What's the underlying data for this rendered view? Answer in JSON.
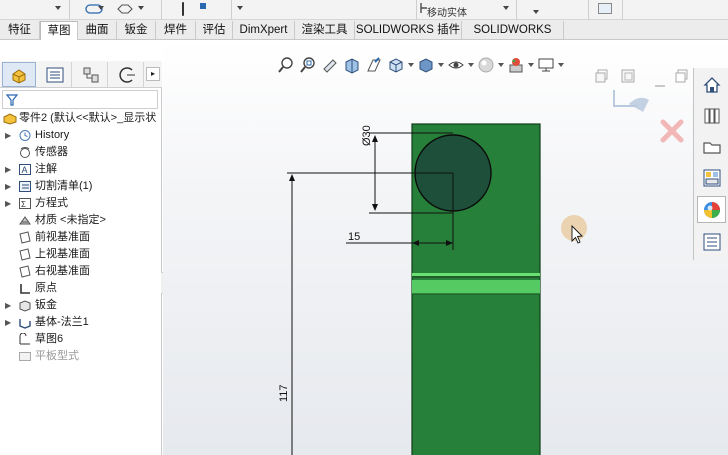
{
  "ribbon": {
    "partial_label": "移动实体",
    "partial_label_right": "…"
  },
  "tabs": [
    {
      "label": "特征",
      "active": false
    },
    {
      "label": "草图",
      "active": true
    },
    {
      "label": "曲面",
      "active": false
    },
    {
      "label": "钣金",
      "active": false
    },
    {
      "label": "焊件",
      "active": false
    },
    {
      "label": "评估",
      "active": false
    },
    {
      "label": "DimXpert",
      "active": false
    },
    {
      "label": "渲染工具",
      "active": false
    },
    {
      "label": "SOLIDWORKS 插件",
      "active": false
    },
    {
      "label": "SOLIDWORKS MBD",
      "active": false
    }
  ],
  "tree": {
    "root": "零件2  (默认<<默认>_显示状",
    "items": [
      {
        "label": "History",
        "icon": "history-icon",
        "expandable": true
      },
      {
        "label": "传感器",
        "icon": "sensor-icon",
        "expandable": false
      },
      {
        "label": "注解",
        "icon": "annotation-icon",
        "expandable": true
      },
      {
        "label": "切割清单(1)",
        "icon": "cut-list-icon",
        "expandable": true
      },
      {
        "label": "方程式",
        "icon": "equation-icon",
        "expandable": true
      },
      {
        "label": "材质 <未指定>",
        "icon": "material-icon",
        "expandable": false
      },
      {
        "label": "前视基准面",
        "icon": "plane-icon",
        "expandable": false
      },
      {
        "label": "上视基准面",
        "icon": "plane-icon",
        "expandable": false
      },
      {
        "label": "右视基准面",
        "icon": "plane-icon",
        "expandable": false
      },
      {
        "label": "原点",
        "icon": "origin-icon",
        "expandable": false
      },
      {
        "label": "钣金",
        "icon": "sheet-metal-icon",
        "expandable": true
      },
      {
        "label": "基体-法兰1",
        "icon": "base-flange-icon",
        "expandable": true
      },
      {
        "label": "草图6",
        "icon": "sketch-icon",
        "expandable": false
      },
      {
        "label": "平板型式",
        "icon": "flat-pattern-icon",
        "expandable": false,
        "disabled": true
      }
    ]
  },
  "dimensions": {
    "diameter": "Ø30",
    "horizontal": "15",
    "vertical": "117"
  },
  "colors": {
    "part_green": "#27803a",
    "hole_dark": "#1d4f3a",
    "bend_green": "#5fd36a",
    "accent_blue": "#2a68b0",
    "cursor_highlight": "#e8c79a"
  }
}
